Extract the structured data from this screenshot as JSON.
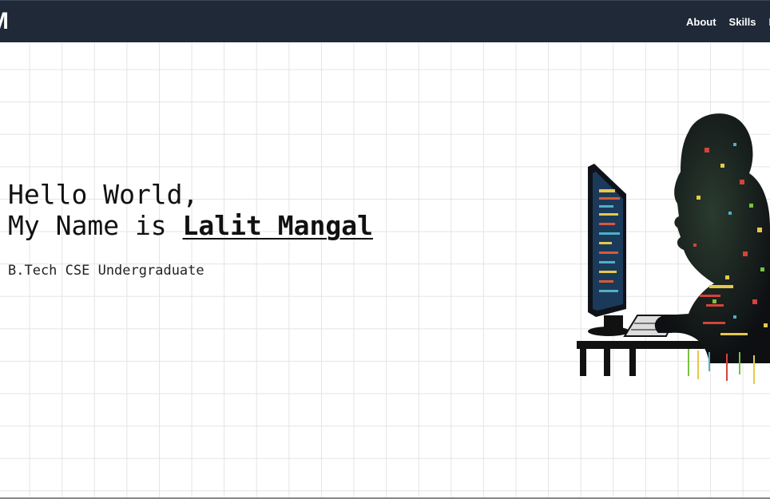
{
  "header": {
    "logo": "M",
    "nav": [
      "About",
      "Skills",
      "P"
    ]
  },
  "hero": {
    "greeting": "Hello World,",
    "intro_prefix": "My Name is ",
    "name": "Lalit Mangal",
    "subtitle": "B.Tech CSE Undergraduate"
  },
  "colors": {
    "navbar": "#1f2937",
    "text": "#111111",
    "grid": "#e4e4e4"
  },
  "illustration": {
    "icon": "programmer-at-computer-illustration"
  }
}
